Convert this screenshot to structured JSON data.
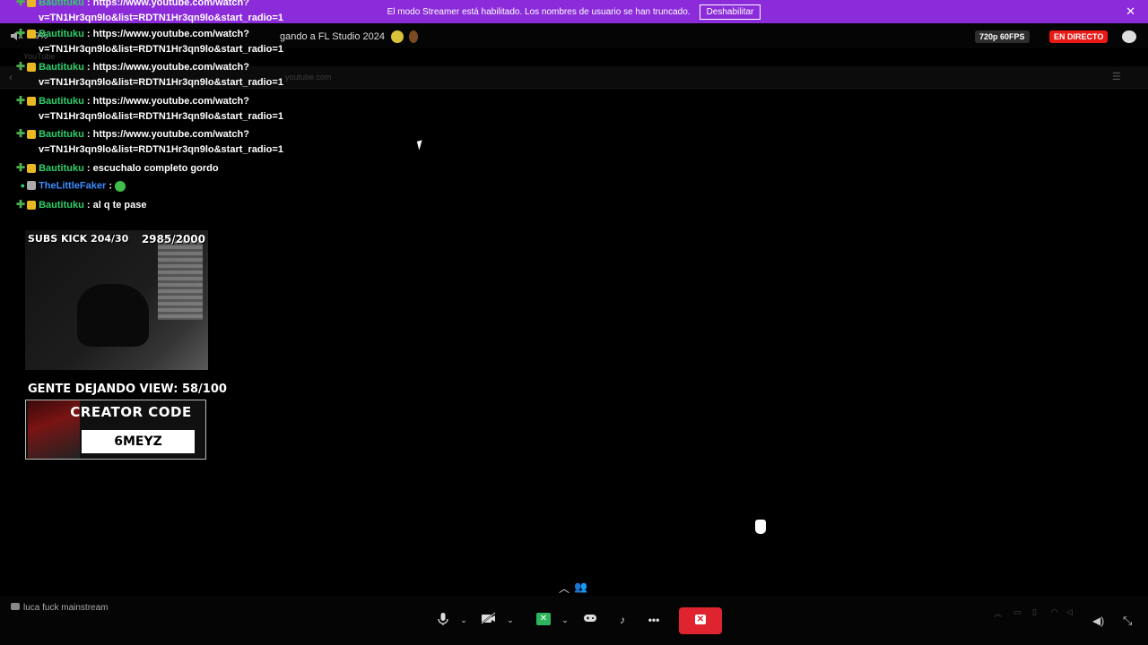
{
  "banner": {
    "text": "El modo Streamer está habilitado. Los nombres de usuario se han truncado.",
    "button": "Deshabilitar"
  },
  "stream": {
    "volume_pct": "19%",
    "title": "gando a FL Studio 2024",
    "quality": "720p 60FPS",
    "live": "EN DIRECTO"
  },
  "browser": {
    "tab": "YouTube",
    "url": "youtube.com"
  },
  "chat": {
    "messages": [
      {
        "user": "Bautituku",
        "text": "https://www.youtube.com/watch?",
        "cont": "v=TN1Hr3qn9lo&list=RDTN1Hr3qn9lo&start_radio=1"
      },
      {
        "user": "Bautituku",
        "text": "https://www.youtube.com/watch?",
        "cont": "v=TN1Hr3qn9lo&list=RDTN1Hr3qn9lo&start_radio=1"
      },
      {
        "user": "Bautituku",
        "text": "https://www.youtube.com/watch?",
        "cont": "v=TN1Hr3qn9lo&list=RDTN1Hr3qn9lo&start_radio=1"
      },
      {
        "user": "Bautituku",
        "text": "https://www.youtube.com/watch?",
        "cont": "v=TN1Hr3qn9lo&list=RDTN1Hr3qn9lo&start_radio=1"
      },
      {
        "user": "Bautituku",
        "text": "https://www.youtube.com/watch?",
        "cont": "v=TN1Hr3qn9lo&list=RDTN1Hr3qn9lo&start_radio=1"
      },
      {
        "user": "Bautituku",
        "text": "escuchalo completo gordo"
      },
      {
        "user": "TheLittleFaker",
        "text": ""
      },
      {
        "user": "Bautituku",
        "text": "al q te pase"
      }
    ],
    "separator": ":"
  },
  "overlay": {
    "subs_label": "SUBS KICK 204/30",
    "followers_label": "2985/2000",
    "view_goal": "GENTE DEJANDO VIEW: 58/100",
    "creator_title": "CREATOR CODE",
    "creator_code": "6MEYZ"
  },
  "call": {
    "channel": "luca fuck mainstream"
  },
  "icons": {
    "volume": "speaker-icon",
    "mic": "microphone-icon",
    "camera_off": "camera-off-icon",
    "screen_share": "screen-share-icon",
    "activity": "gamepad-icon",
    "soundboard": "soundboard-icon",
    "more": "more-icon",
    "end_call": "end-call-icon"
  },
  "colors": {
    "banner": "#8b2bd9",
    "live": "#e91916",
    "username": "#2fcf6a",
    "username_alt": "#3b8cff",
    "end_call": "#e0242f",
    "share_active": "#2db55d"
  }
}
